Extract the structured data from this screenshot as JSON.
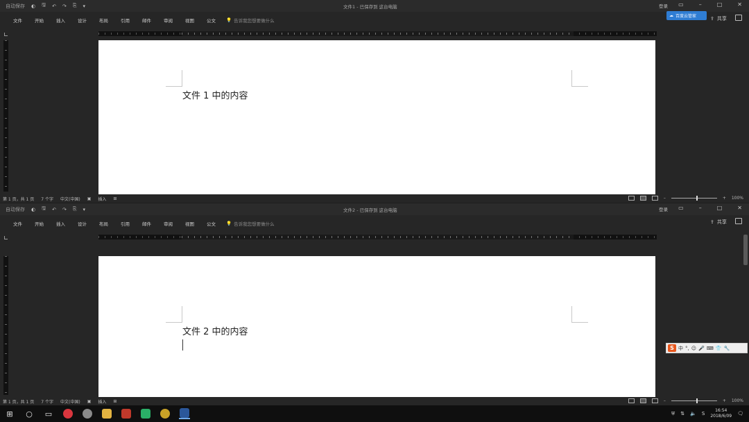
{
  "window1": {
    "qat": {
      "autosave": "自动保存",
      "save_icon": "save-icon",
      "undo_icon": "undo-icon",
      "redo_icon": "redo-icon"
    },
    "title": "文件1 - 已保存到 这台电脑",
    "login": "登录",
    "tabs": [
      "文件",
      "开始",
      "插入",
      "设计",
      "布局",
      "引用",
      "邮件",
      "审阅",
      "视图",
      "公文"
    ],
    "tell_me": "告诉我您想要做什么",
    "share": "共享",
    "doc_text": "文件 1 中的内容",
    "status": {
      "page": "第 1 页，共 1 页",
      "words": "7 个字",
      "lang": "中文(中国)",
      "mode": "插入",
      "zoom": "100%"
    }
  },
  "window2": {
    "qat": {
      "autosave": "自动保存",
      "save_icon": "save-icon",
      "undo_icon": "undo-icon",
      "redo_icon": "redo-icon"
    },
    "title": "文件2 - 已保存到 这台电脑",
    "login": "登录",
    "tabs": [
      "文件",
      "开始",
      "插入",
      "设计",
      "布局",
      "引用",
      "邮件",
      "审阅",
      "视图",
      "公文"
    ],
    "tell_me": "告诉我您想要做什么",
    "share": "共享",
    "doc_text": "文件 2 中的内容",
    "status": {
      "page": "第 1 页，共 1 页",
      "words": "7 个字",
      "lang": "中文(中国)",
      "mode": "插入",
      "zoom": "100%"
    }
  },
  "cloud_badge": "百度云管家",
  "ime": {
    "logo": "S",
    "items": [
      "中",
      "°,",
      "☺",
      "🎤",
      "⌨",
      "👕",
      "🔧"
    ]
  },
  "taskbar": {
    "apps": [
      "windows-start-icon",
      "search-circle-icon",
      "task-view-icon",
      "netease-music-icon",
      "browser-icon",
      "file-explorer-icon",
      "wps-pdf-icon",
      "wechat-icon",
      "chrome-icon",
      "word-icon"
    ],
    "time": "16:54",
    "date": "2018/6/09"
  }
}
